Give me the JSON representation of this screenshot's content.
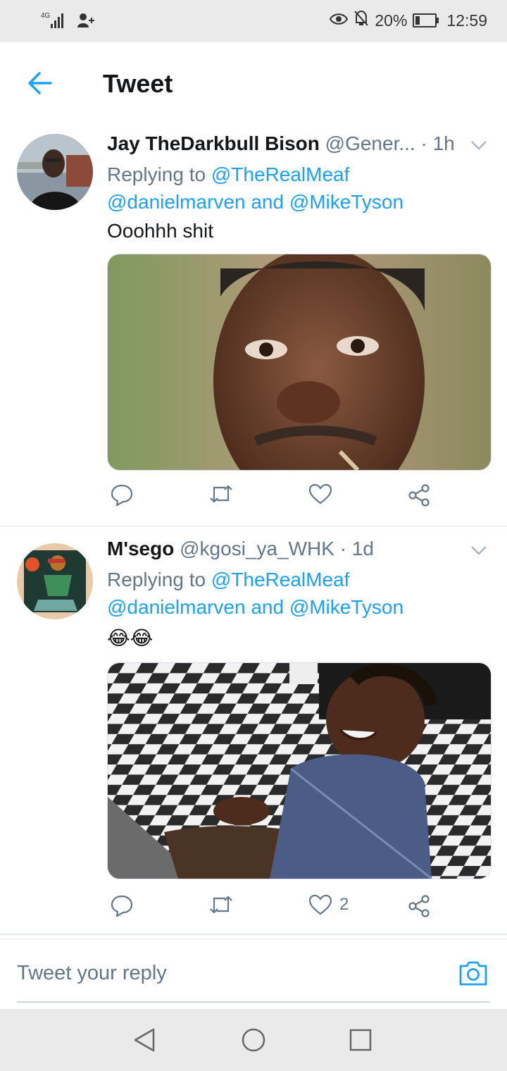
{
  "status_bar": {
    "network": "4G",
    "battery_percent": "20%",
    "time": "12:59",
    "icons": [
      "signal-icon",
      "person-add-icon",
      "eye-icon",
      "notifications-off-icon",
      "battery-icon"
    ]
  },
  "header": {
    "title": "Tweet",
    "back_icon": "arrow-left-icon"
  },
  "tweets": [
    {
      "name": "Jay TheDarkbull Bison",
      "handle": "@Gener...",
      "time": "· 1h",
      "replying_prefix": "Replying to",
      "reply_to_1": "@TheRealMeaf",
      "reply_to_2": "@danielmarven",
      "reply_and": "and",
      "reply_to_3": "@MikeTyson",
      "text": "Ooohhh shit",
      "like_count": ""
    },
    {
      "name": "M'sego",
      "handle": "@kgosi_ya_WHK",
      "time": "· 1d",
      "replying_prefix": "Replying to",
      "reply_to_1": "@TheRealMeaf",
      "reply_to_2": "@danielmarven",
      "reply_and": "and",
      "reply_to_3": "@MikeTyson",
      "text": "😂😂",
      "like_count": "2"
    }
  ],
  "reply_bar": {
    "placeholder": "Tweet your reply",
    "camera_icon": "camera-icon"
  },
  "colors": {
    "accent": "#1da1f2",
    "muted": "#657786",
    "text": "#14171a"
  }
}
